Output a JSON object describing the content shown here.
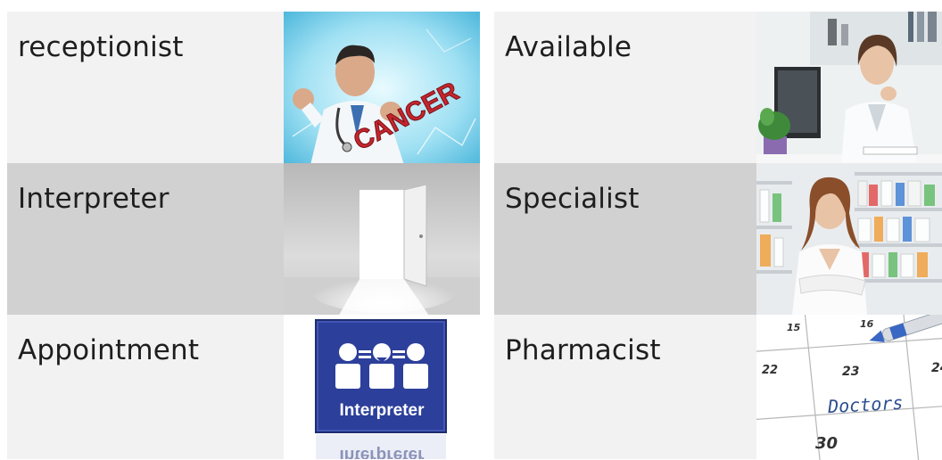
{
  "grid": {
    "left_column": [
      {
        "label": "receptionist",
        "image": "doctor-cancer-photo"
      },
      {
        "label": "Interpreter",
        "image": "open-door-photo"
      },
      {
        "label": "Appointment",
        "image": "interpreter-sign"
      }
    ],
    "right_column": [
      {
        "label": "Available",
        "image": "doctor-at-desk-photo"
      },
      {
        "label": "Specialist",
        "image": "pharmacist-photo"
      },
      {
        "label": "Pharmacist",
        "image": "calendar-doctors-photo"
      }
    ]
  },
  "images": {
    "cancer_word": "CANCER",
    "sign_label": "Interpreter",
    "calendar": {
      "numbers": [
        "15",
        "16",
        "22",
        "23",
        "24",
        "30"
      ],
      "note": "Doctors"
    }
  },
  "colors": {
    "light_cell": "#f2f2f2",
    "gray_cell": "#d1d1d1",
    "sign_blue": "#2c3f9a"
  }
}
